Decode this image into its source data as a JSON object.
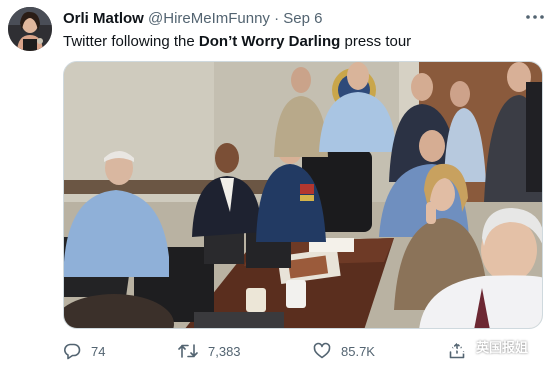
{
  "tweet": {
    "author": {
      "display_name": "Orli Matlow",
      "handle": "@HireMeImFunny",
      "separator": "·",
      "date": "Sep 6"
    },
    "text": {
      "before": "Twitter following the ",
      "bold": "Don’t Worry Darling",
      "after": " press tour"
    },
    "actions": {
      "replies": "74",
      "retweets": "7,383",
      "likes": "85.7K"
    }
  },
  "watermark": {
    "label": "英国报姐"
  },
  "icons": {
    "more": "more-horizontal-icon",
    "reply": "reply-icon",
    "retweet": "retweet-icon",
    "like": "heart-icon",
    "share": "share-icon"
  },
  "colors": {
    "text": "#0f1419",
    "secondary": "#536471",
    "border": "#cfd9de"
  }
}
